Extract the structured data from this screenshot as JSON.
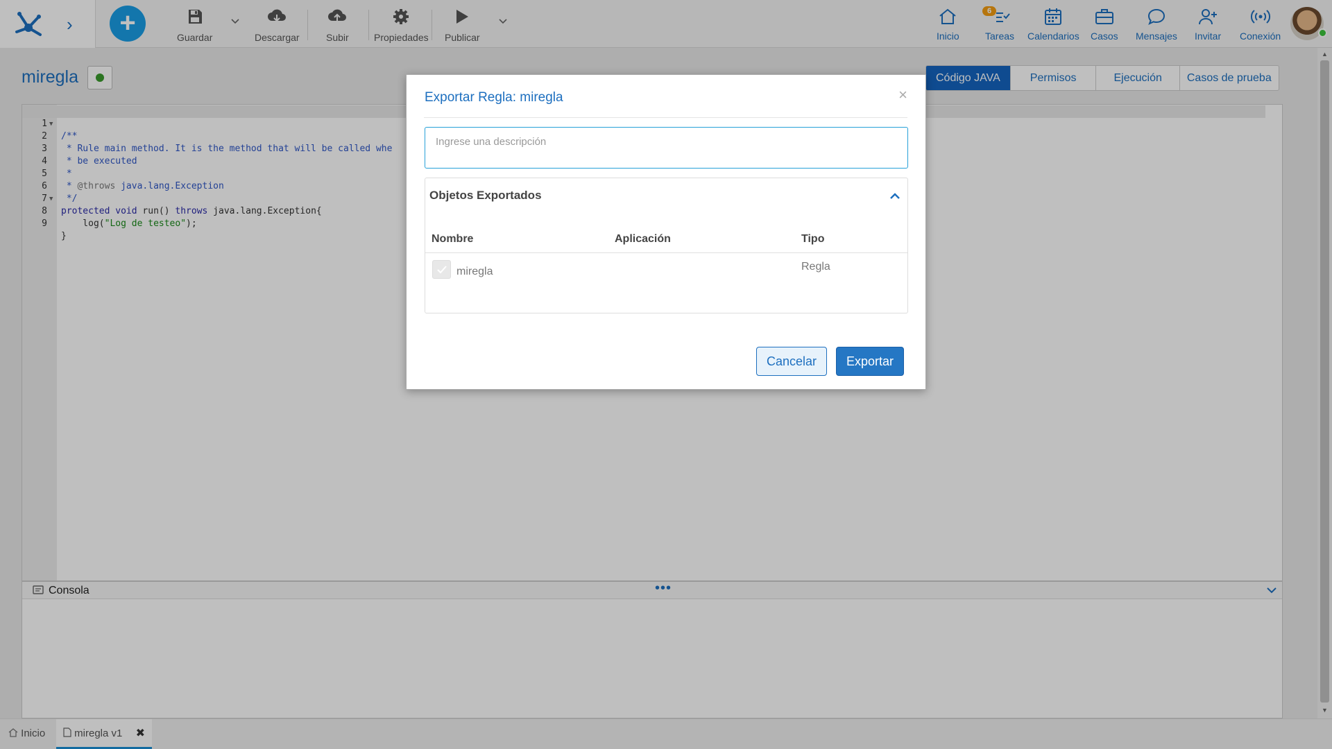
{
  "toolbar": {
    "items": [
      {
        "label": "Guardar",
        "icon": "save-icon"
      },
      {
        "label": "Descargar",
        "icon": "cloud-download-icon"
      },
      {
        "label": "Subir",
        "icon": "cloud-upload-icon"
      },
      {
        "label": "Propiedades",
        "icon": "gear-icon"
      },
      {
        "label": "Publicar",
        "icon": "play-icon"
      }
    ]
  },
  "nav": {
    "items": [
      {
        "label": "Inicio",
        "icon": "home-icon"
      },
      {
        "label": "Tareas",
        "icon": "tasks-icon",
        "badge": "6"
      },
      {
        "label": "Calendarios",
        "icon": "calendar-icon"
      },
      {
        "label": "Casos",
        "icon": "briefcase-icon"
      },
      {
        "label": "Mensajes",
        "icon": "chat-icon"
      },
      {
        "label": "Invitar",
        "icon": "add-user-icon"
      },
      {
        "label": "Conexión",
        "icon": "broadcast-icon"
      }
    ],
    "status_color": "#3cc43c"
  },
  "editor": {
    "rule_name": "miregla",
    "tabs": [
      "Código JAVA",
      "Permisos",
      "Ejecución",
      "Casos de prueba"
    ],
    "active_tab": "Código JAVA",
    "line_numbers": [
      "1",
      "2",
      "3",
      "4",
      "5",
      "6",
      "7",
      "8",
      "9"
    ],
    "code": {
      "l1": "/**",
      "l2": " * Rule main method. It is the method that will be called whe",
      "l3": " * be executed",
      "l4": " *",
      "l5_tag": "@throws",
      "l5_rest": " java.lang.Exception",
      "l6": " */",
      "l7_kw1": "protected",
      "l7_kw2": "void",
      "l7_mid": " run() ",
      "l7_kw3": "throws",
      "l7_rest": " java.lang.Exception{",
      "l8_pre": "    log(",
      "l8_str": "\"Log de testeo\"",
      "l8_post": ");",
      "l9": "}"
    },
    "console_title": "Consola"
  },
  "bottom_tabs": [
    {
      "label": "Inicio"
    },
    {
      "label": "miregla v1"
    }
  ],
  "dialog": {
    "title": "Exportar Regla: miregla",
    "description_placeholder": "Ingrese una descripción",
    "description_value": "",
    "panel_title": "Objetos Exportados",
    "columns": [
      "Nombre",
      "Aplicación",
      "Tipo"
    ],
    "rows": [
      {
        "nombre": "miregla",
        "aplicacion": "",
        "tipo": "Regla",
        "checked": true
      }
    ],
    "cancel_label": "Cancelar",
    "export_label": "Exportar"
  },
  "colors": {
    "accent": "#1d6fbf",
    "primary_button": "#2577c4",
    "add_button": "#1a9ee6",
    "badge": "#f39c12"
  }
}
